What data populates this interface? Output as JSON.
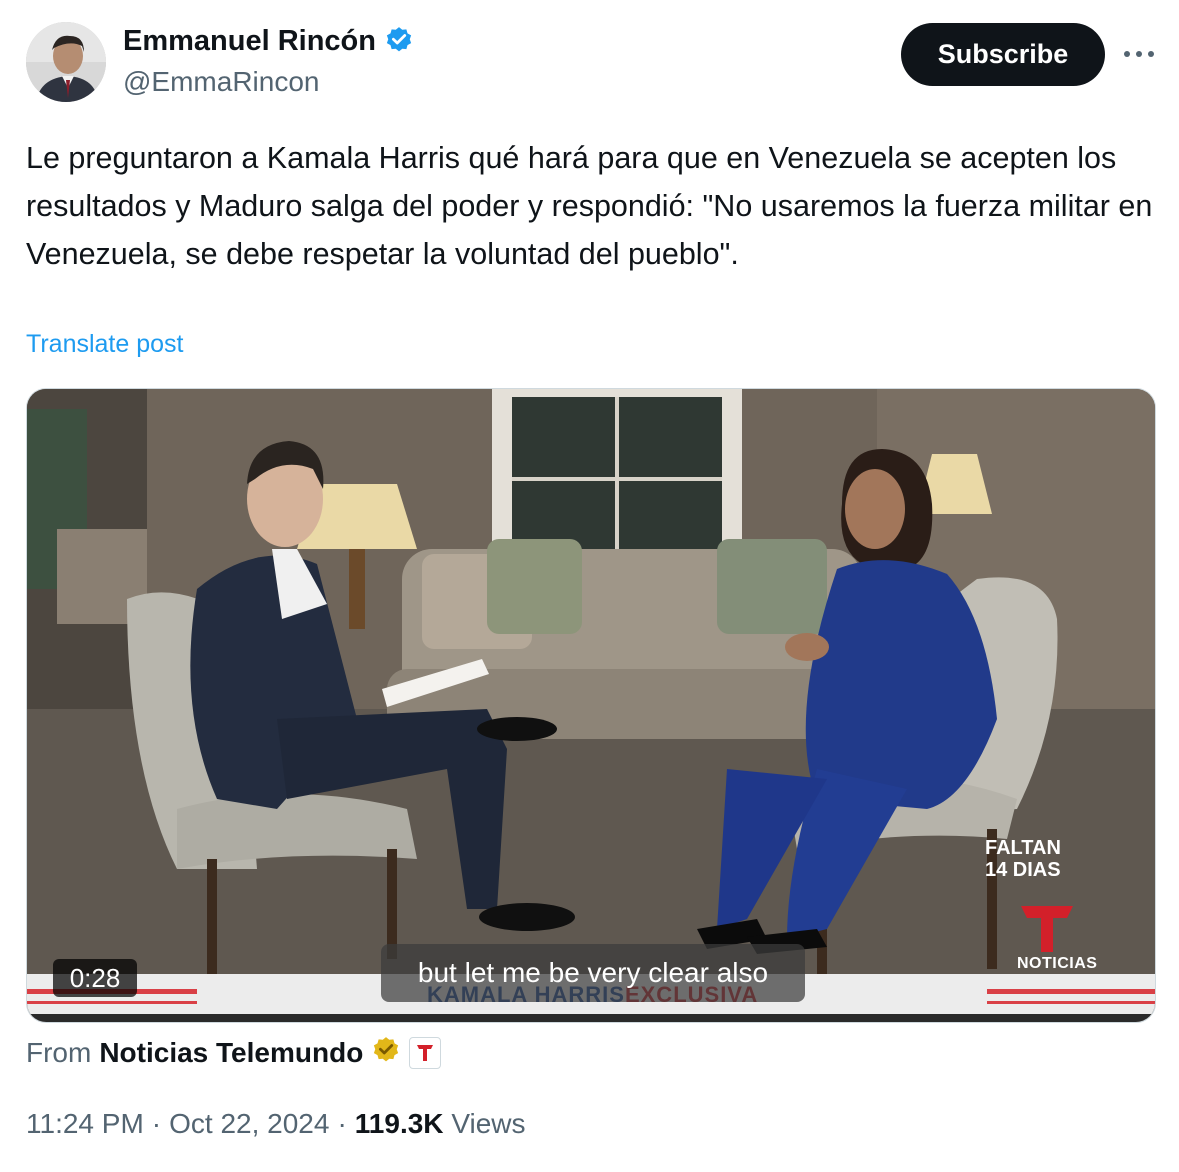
{
  "author": {
    "name": "Emmanuel Rincón",
    "handle": "@EmmaRincon",
    "verified_color": "#1d9bf0"
  },
  "actions": {
    "subscribe_label": "Subscribe",
    "more_icon": "more-horizontal-icon"
  },
  "post": {
    "text": "Le preguntaron a Kamala Harris qué hará para que en Venezuela se acepten los resultados y Maduro salga del poder y respondió: \"No usaremos la fuerza militar en Venezuela, se debe respetar la voluntad del pueblo\".",
    "translate_label": "Translate post"
  },
  "video": {
    "duration": "0:28",
    "caption": "but let me be very clear also",
    "lower_third_name": "KAMALA HARRIS",
    "lower_third_tag": "EXCLUSIVA",
    "countdown_line1": "FALTAN",
    "countdown_line2": "14 DIAS",
    "network_label": "NOTICIAS"
  },
  "source": {
    "from_label": "From",
    "name": "Noticias Telemundo",
    "badge_color": "#e2b719"
  },
  "meta": {
    "time": "11:24 PM",
    "separator": "·",
    "date": "Oct 22, 2024",
    "views_count": "119.3K",
    "views_label": "Views"
  },
  "colors": {
    "link": "#1d9bf0",
    "secondary_text": "#536471",
    "primary_text": "#0f1419",
    "telemundo_red": "#d3202a"
  }
}
